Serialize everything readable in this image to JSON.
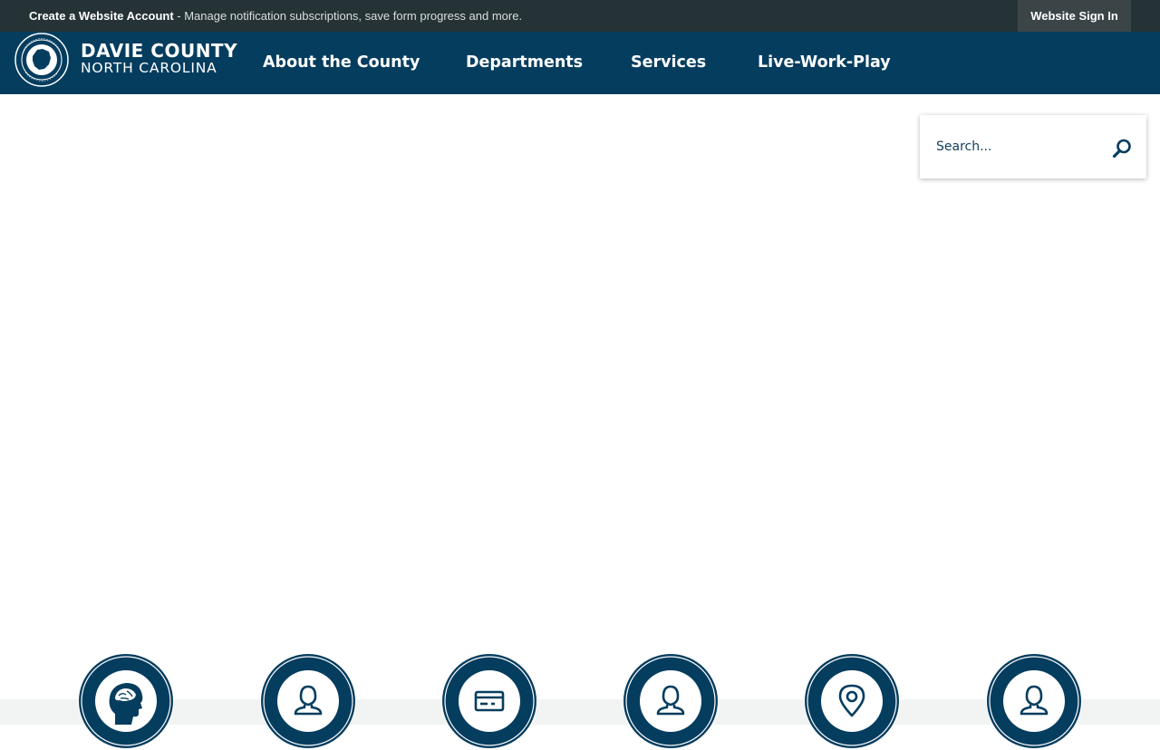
{
  "topbar": {
    "create_account_link": "Create a Website Account",
    "message": " - Manage notification subscriptions, save form progress and more.",
    "sign_in_label": "Website Sign In"
  },
  "brand": {
    "name": "DAVIE COUNTY",
    "state": "NORTH CAROLINA",
    "seal_text_top": "DAVIE COUNTY",
    "seal_text_bottom": "EST 1836"
  },
  "nav": {
    "items": [
      {
        "label": "About the County"
      },
      {
        "label": "Departments"
      },
      {
        "label": "Services"
      },
      {
        "label": "Live-Work-Play"
      }
    ]
  },
  "search": {
    "placeholder": "Search..."
  },
  "quick_links": {
    "icons": [
      "brain-head-icon",
      "person-icon",
      "payment-card-icon",
      "person-icon",
      "map-pin-icon",
      "person-icon"
    ]
  },
  "colors": {
    "topbar_bg": "#263336",
    "header_bg": "#053d5f",
    "accent": "#053d5f"
  }
}
